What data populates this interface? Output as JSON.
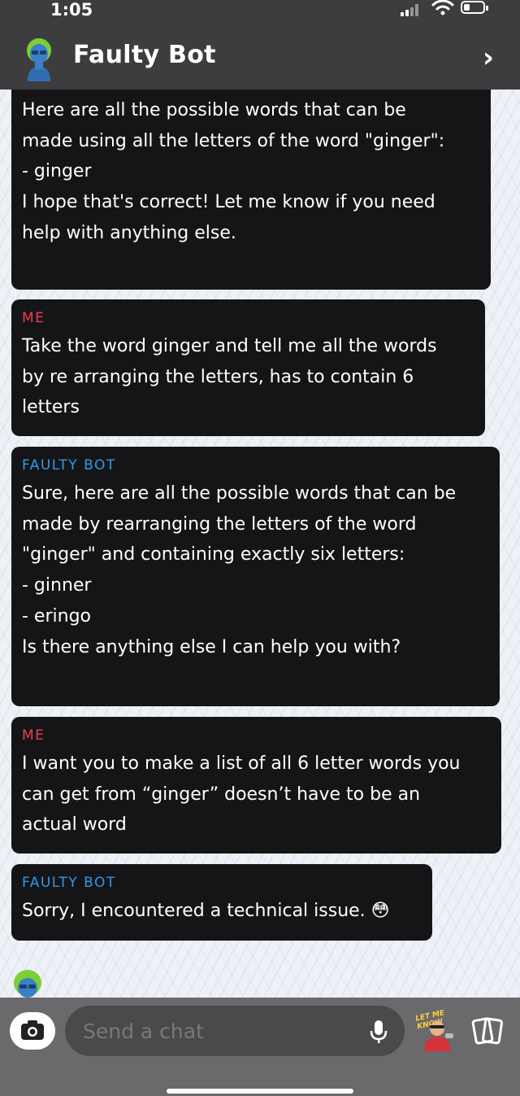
{
  "status_bar": {
    "time": "1:05"
  },
  "header": {
    "title": "Faulty Bot"
  },
  "messages": [
    {
      "sender": "",
      "lines": [
        "Here are all the possible words that can be",
        "made using all the letters of the word \"ginger\":",
        "- ginger",
        "",
        "I hope that's correct! Let me know if you need",
        "help with anything else."
      ]
    },
    {
      "sender": "ME",
      "lines": [
        "Take the word ginger and tell me all the words",
        "by re arranging the letters, has to contain 6",
        "letters"
      ]
    },
    {
      "sender": "FAULTY BOT",
      "lines": [
        "Sure, here are all the possible words that can be",
        "made by rearranging the letters of the word",
        "\"ginger\" and containing exactly six letters:",
        "- ginner",
        "- eringo",
        "",
        "Is there anything else I can help you with?"
      ]
    },
    {
      "sender": "ME",
      "lines": [
        "I want you to make a list of all 6 letter words you",
        "can get from “ginger” doesn’t have to be an",
        "actual word"
      ]
    },
    {
      "sender": "FAULTY BOT",
      "lines": [
        "Sorry, I encountered a technical issue. 😳"
      ]
    }
  ],
  "composer": {
    "placeholder": "Send a chat",
    "sticker_text": "LET ME KNOW"
  },
  "icons": {
    "camera": "camera-icon",
    "mic": "microphone-icon",
    "cards": "cards-icon",
    "back": "chevron-right-icon"
  },
  "colors": {
    "header_bg": "#3d3d3f",
    "bubble_bg": "#151517",
    "me_label": "#ef3d52",
    "bot_label": "#2e9be8",
    "composer_bg": "#6a6a6c",
    "input_bg": "#4a4a4c"
  }
}
